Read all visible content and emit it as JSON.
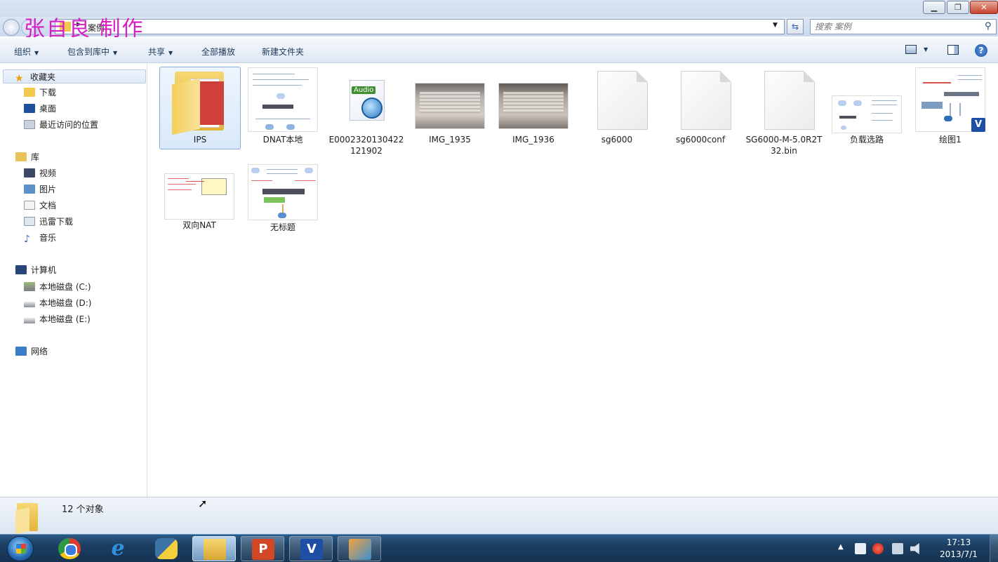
{
  "watermark": "张自良 制作",
  "address": {
    "current": "案例"
  },
  "search": {
    "placeholder": "搜索 案例"
  },
  "toolbar": {
    "organize": "组织",
    "include_in_library": "包含到库中",
    "share": "共享",
    "play_all": "全部播放",
    "new_folder": "新建文件夹"
  },
  "nav": {
    "favorites": "收藏夹",
    "downloads": "下载",
    "desktop": "桌面",
    "recent": "最近访问的位置",
    "libraries": "库",
    "videos": "视频",
    "pictures": "图片",
    "documents": "文档",
    "thunder": "迅雷下载",
    "music": "音乐",
    "computer": "计算机",
    "disk_c": "本地磁盘 (C:)",
    "disk_d": "本地磁盘 (D:)",
    "disk_e": "本地磁盘 (E:)",
    "network": "网络"
  },
  "files": [
    {
      "name": "IPS",
      "icon": "folder-icon"
    },
    {
      "name": "DNAT本地",
      "icon": "diagram-thumbnail"
    },
    {
      "name": "E0002320130422121902",
      "icon": "audio-file-icon",
      "badge": "Audio"
    },
    {
      "name": "IMG_1935",
      "icon": "photo-thumbnail"
    },
    {
      "name": "IMG_1936",
      "icon": "photo-thumbnail"
    },
    {
      "name": "sg6000",
      "icon": "blank-file-icon"
    },
    {
      "name": "sg6000conf",
      "icon": "blank-file-icon"
    },
    {
      "name": "SG6000-M-5.0R2T32.bin",
      "icon": "blank-file-icon"
    },
    {
      "name": "负载选路",
      "icon": "diagram-thumbnail"
    },
    {
      "name": "绘图1",
      "icon": "visio-thumbnail",
      "badge": "V"
    },
    {
      "name": "双向NAT",
      "icon": "diagram-thumbnail"
    },
    {
      "name": "无标题",
      "icon": "diagram-thumbnail"
    }
  ],
  "status": {
    "count": "12 个对象"
  },
  "taskbar": {
    "apps": [
      "chrome-icon",
      "ie-icon",
      "python-icon",
      "explorer-icon",
      "powerpoint-icon",
      "visio-icon",
      "vmware-icon"
    ],
    "time": "17:13",
    "date": "2013/7/1"
  }
}
